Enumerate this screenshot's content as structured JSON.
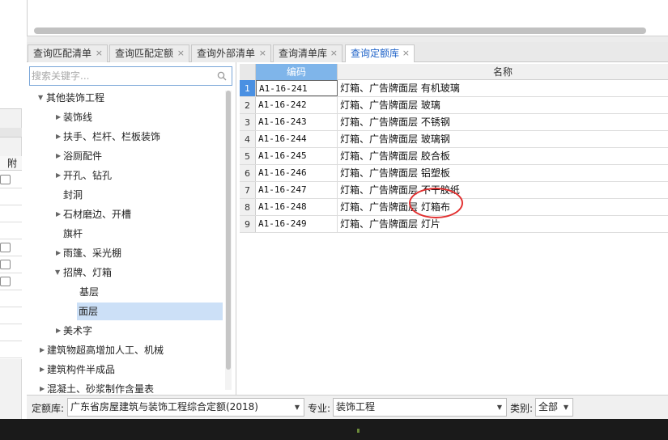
{
  "left_strip": {
    "label": "附加"
  },
  "tabs": [
    {
      "label": "查询匹配清单",
      "close": "×"
    },
    {
      "label": "查询匹配定额",
      "close": "×"
    },
    {
      "label": "查询外部清单",
      "close": "×"
    },
    {
      "label": "查询清单库",
      "close": "×"
    },
    {
      "label": "查询定额库",
      "close": "×"
    }
  ],
  "search": {
    "placeholder": "搜索关键字..."
  },
  "tree": [
    {
      "label": "其他装饰工程",
      "arrow": "▼"
    },
    {
      "label": "装饰线",
      "arrow": "▶"
    },
    {
      "label": "扶手、栏杆、栏板装饰",
      "arrow": "▶"
    },
    {
      "label": "浴厕配件",
      "arrow": "▶"
    },
    {
      "label": "开孔、钻孔",
      "arrow": "▶"
    },
    {
      "label": "封洞",
      "arrow": ""
    },
    {
      "label": "石材磨边、开槽",
      "arrow": "▶"
    },
    {
      "label": "旗杆",
      "arrow": ""
    },
    {
      "label": "雨篷、采光棚",
      "arrow": "▶"
    },
    {
      "label": "招牌、灯箱",
      "arrow": "▼"
    },
    {
      "label": "基层",
      "arrow": ""
    },
    {
      "label": "面层",
      "arrow": ""
    },
    {
      "label": "美术字",
      "arrow": "▶"
    },
    {
      "label": "建筑物超高增加人工、机械",
      "arrow": "▶"
    },
    {
      "label": "建筑构件半成品",
      "arrow": "▶"
    },
    {
      "label": "混凝土、砂浆制作含量表",
      "arrow": "▶"
    }
  ],
  "grid": {
    "headers": {
      "code": "编码",
      "name": "名称"
    },
    "rows": [
      {
        "n": "1",
        "code": "A1-16-241",
        "name": "灯箱、广告牌面层 有机玻璃"
      },
      {
        "n": "2",
        "code": "A1-16-242",
        "name": "灯箱、广告牌面层 玻璃"
      },
      {
        "n": "3",
        "code": "A1-16-243",
        "name": "灯箱、广告牌面层 不锈钢"
      },
      {
        "n": "4",
        "code": "A1-16-244",
        "name": "灯箱、广告牌面层 玻璃钢"
      },
      {
        "n": "5",
        "code": "A1-16-245",
        "name": "灯箱、广告牌面层 胶合板"
      },
      {
        "n": "6",
        "code": "A1-16-246",
        "name": "灯箱、广告牌面层 铝塑板"
      },
      {
        "n": "7",
        "code": "A1-16-247",
        "name": "灯箱、广告牌面层 不干胶纸"
      },
      {
        "n": "8",
        "code": "A1-16-248",
        "name": "灯箱、广告牌面层 灯箱布"
      },
      {
        "n": "9",
        "code": "A1-16-249",
        "name": "灯箱、广告牌面层 灯片"
      }
    ]
  },
  "bottom": {
    "quota_label": "定额库:",
    "quota_value": "广东省房屋建筑与装饰工程综合定额(2018)",
    "major_label": "专业:",
    "major_value": "装饰工程",
    "category_label": "类别:",
    "category_value": "全部"
  },
  "colors": {
    "header_accent": "#7fb5ea",
    "selected_row": "#4a90e2",
    "annotation_circle": "#e23030"
  }
}
